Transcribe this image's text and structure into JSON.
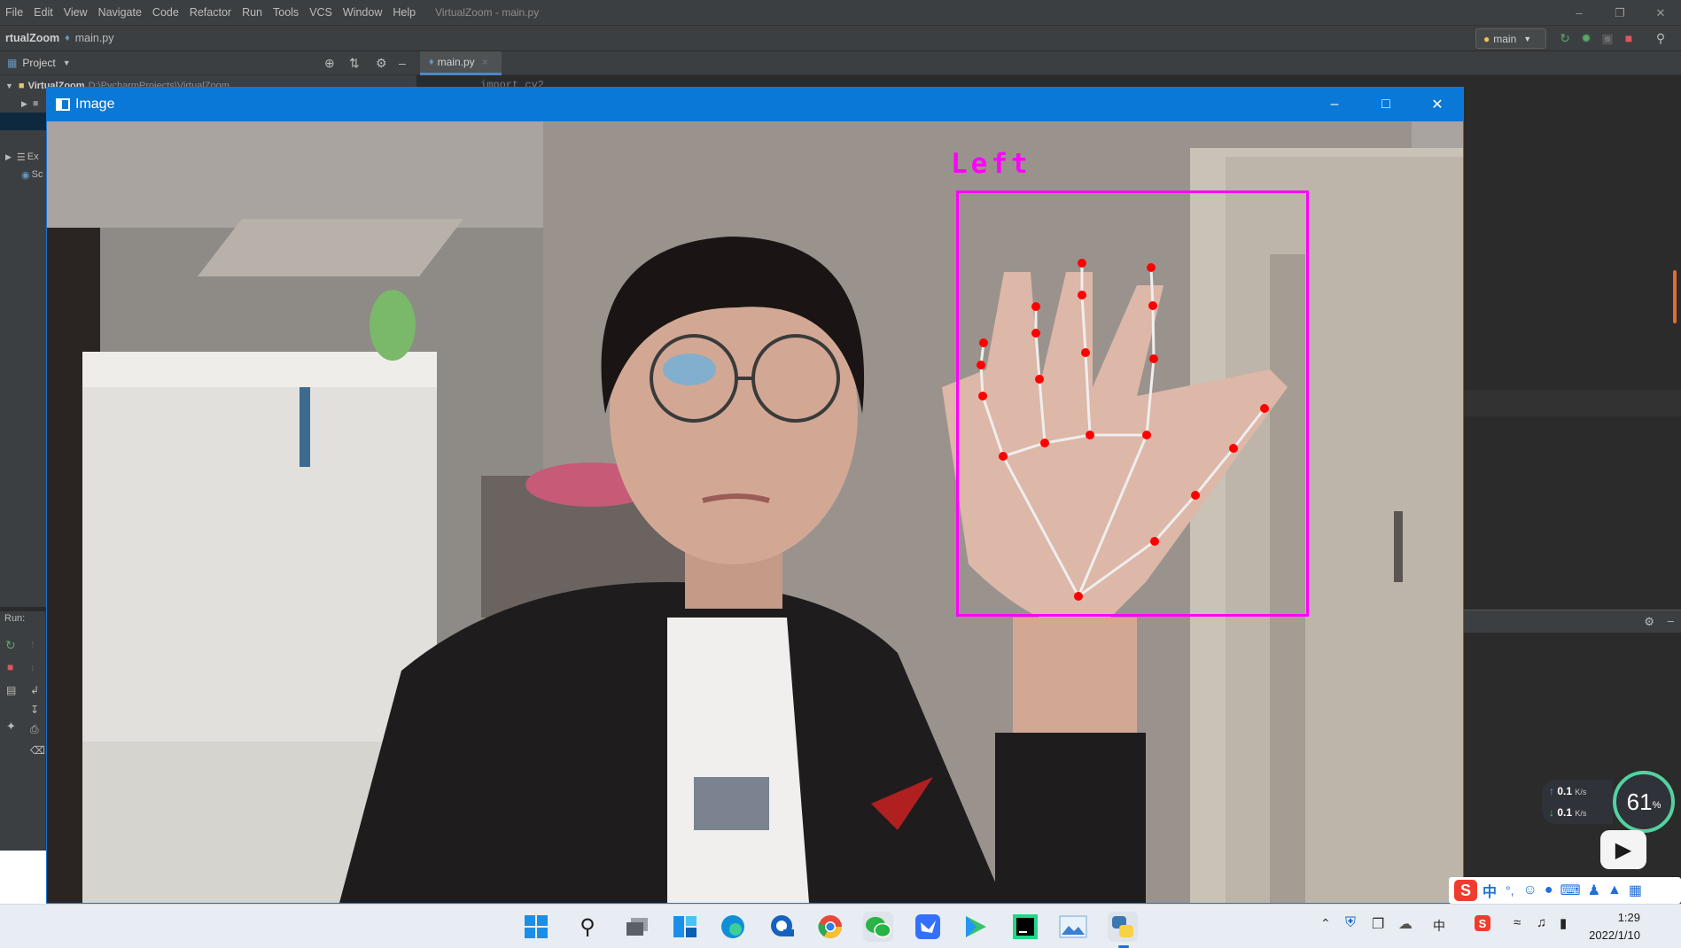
{
  "menubar": {
    "items": [
      "File",
      "Edit",
      "View",
      "Navigate",
      "Code",
      "Refactor",
      "Run",
      "Tools",
      "VCS",
      "Window",
      "Help"
    ],
    "window_title": "VirtualZoom - main.py"
  },
  "navbar": {
    "project": "rtualZoom",
    "file": "main.py",
    "run_config": "main"
  },
  "project_panel": {
    "title": "Project",
    "root_label": "VirtualZoom",
    "root_path": "D:\\PycharmProjects\\VirtualZoom",
    "ext_label": "Ex",
    "scratch_label": "Sc"
  },
  "editor": {
    "tab_label": "main.py",
    "code_peek": "import cv2"
  },
  "run_panel": {
    "label": "Run:"
  },
  "image_window": {
    "title": "Image",
    "hand_label": "Left",
    "hand_box_color": "#ff00ff",
    "landmark_color": "#ff0000"
  },
  "network_widget": {
    "upload": "0.1",
    "upload_unit": "K/s",
    "download": "0.1",
    "download_unit": "K/s",
    "cpu_percent": "61",
    "percent_sign": "%"
  },
  "ime": {
    "mode": "中"
  },
  "taskbar": {
    "apps": [
      "start-icon",
      "search-icon",
      "task-view-icon",
      "widgets-icon",
      "edge-icon",
      "onedrive-icon",
      "chrome-icon",
      "wechat-icon",
      "feishu-icon",
      "video-player-icon",
      "pycharm-icon",
      "photos-icon",
      "python-icon"
    ],
    "tray_lang": "中",
    "time": "1:29",
    "date": "2022/1/10"
  }
}
